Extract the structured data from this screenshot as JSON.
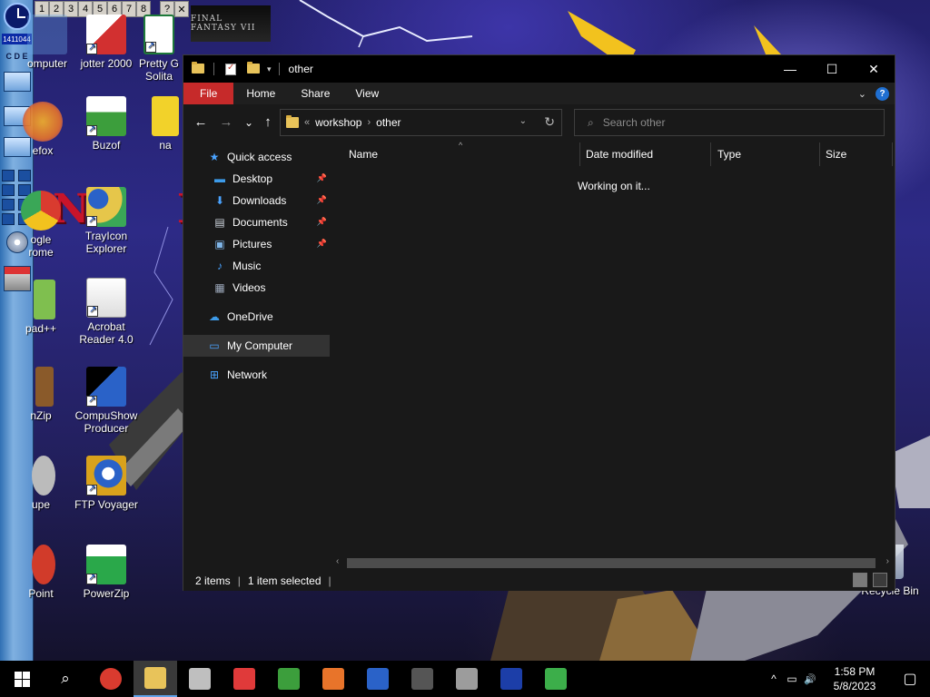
{
  "desktop": {
    "banner_text": "FINAL FANTASY VII",
    "pager": {
      "desktops": [
        "1",
        "2",
        "3",
        "4",
        "5",
        "6",
        "7",
        "8"
      ],
      "help": "?",
      "close": "✕"
    },
    "left_bar": {
      "counter": "1411044",
      "cde": "C D E"
    },
    "icons": [
      {
        "id": "computer",
        "label": "omputer",
        "color": "#6aa6e8"
      },
      {
        "id": "jotter",
        "label": "jotter 2000",
        "color": "#d23030"
      },
      {
        "id": "pretty-good-solitaire",
        "label": "Pretty G Solita",
        "color": "#1e7a3a"
      },
      {
        "id": "firefox",
        "label": "efox",
        "color": "#e8742a"
      },
      {
        "id": "buzof",
        "label": "Buzof",
        "color": "#3c9e3c"
      },
      {
        "id": "na",
        "label": "na",
        "color": "#f2d22a"
      },
      {
        "id": "chrome",
        "label": "ogle\nrome",
        "color": "#d93b2f"
      },
      {
        "id": "trayicon-explorer",
        "label": "TrayIcon\nExplorer",
        "color": "#e6c64a"
      },
      {
        "id": "notepad",
        "label": "pad++",
        "color": "#7fbf4f"
      },
      {
        "id": "acrobat-reader",
        "label": "Acrobat\nReader 4.0",
        "color": "#c8102e"
      },
      {
        "id": "winzip",
        "label": "nZip",
        "color": "#8a5a2a"
      },
      {
        "id": "compushow",
        "label": "CompuShow\nProducer",
        "color": "#2a62c8"
      },
      {
        "id": "loupe",
        "label": "upe",
        "color": "#bbbbbb"
      },
      {
        "id": "ftp-voyager",
        "label": "FTP Voyager",
        "color": "#d9a21c"
      },
      {
        "id": "powerpoint",
        "label": "Point",
        "color": "#d13b2a"
      },
      {
        "id": "powerzip",
        "label": "PowerZip",
        "color": "#2aa84a"
      }
    ],
    "recycle_bin": "Recycle Bin"
  },
  "explorer": {
    "title": "other",
    "controls": {
      "minimize": "—",
      "maximize": "☐",
      "close": "✕"
    },
    "ribbon": {
      "tabs": [
        "File",
        "Home",
        "Share",
        "View"
      ]
    },
    "nav": {
      "back": "←",
      "forward": "→",
      "recent": "⌄",
      "up": "↑"
    },
    "address": {
      "overflow": "«",
      "crumbs": [
        "workshop",
        "other"
      ],
      "separator": "›"
    },
    "search": {
      "placeholder": "Search other"
    },
    "sidebar": [
      {
        "id": "quick-access",
        "label": "Quick access",
        "icon": "star-icon",
        "glyph": "★",
        "color": "#4aa3ff",
        "indent": 1,
        "pinned": false
      },
      {
        "id": "desktop",
        "label": "Desktop",
        "icon": "desktop-icon",
        "glyph": "▬",
        "color": "#3d9be9",
        "indent": 2,
        "pinned": true
      },
      {
        "id": "downloads",
        "label": "Downloads",
        "icon": "download-icon",
        "glyph": "⬇",
        "color": "#4aa3ff",
        "indent": 2,
        "pinned": true
      },
      {
        "id": "documents",
        "label": "Documents",
        "icon": "document-icon",
        "glyph": "▤",
        "color": "#cfd6df",
        "indent": 2,
        "pinned": true
      },
      {
        "id": "pictures",
        "label": "Pictures",
        "icon": "pictures-icon",
        "glyph": "▣",
        "color": "#7fb5e8",
        "indent": 2,
        "pinned": true
      },
      {
        "id": "music",
        "label": "Music",
        "icon": "music-icon",
        "glyph": "♪",
        "color": "#4aa3ff",
        "indent": 2,
        "pinned": false
      },
      {
        "id": "videos",
        "label": "Videos",
        "icon": "video-icon",
        "glyph": "▦",
        "color": "#9aa6b8",
        "indent": 2,
        "pinned": false
      },
      {
        "id": "onedrive",
        "label": "OneDrive",
        "icon": "cloud-icon",
        "glyph": "☁",
        "color": "#3d9be9",
        "indent": 1,
        "pinned": false
      },
      {
        "id": "my-computer",
        "label": "My Computer",
        "icon": "computer-icon",
        "glyph": "▭",
        "color": "#4aa3ff",
        "indent": 1,
        "pinned": false,
        "selected": true
      },
      {
        "id": "network",
        "label": "Network",
        "icon": "network-icon",
        "glyph": "⊞",
        "color": "#4aa3ff",
        "indent": 1,
        "pinned": false
      }
    ],
    "columns": [
      "Name",
      "Date modified",
      "Type",
      "Size"
    ],
    "sort_indicator": "^",
    "loading_text": "Working on it...",
    "status": {
      "item_count": "2 items",
      "selection": "1 item selected",
      "separator": "|"
    }
  },
  "taskbar": {
    "start": "start-icon",
    "search": "search-icon",
    "apps": [
      {
        "id": "chrome",
        "color": "#d93b2f"
      },
      {
        "id": "file-explorer",
        "color": "#e8c35a",
        "active": true
      },
      {
        "id": "disk-tool",
        "color": "#bfbfbf"
      },
      {
        "id": "arrow-app",
        "color": "#e03a3a"
      },
      {
        "id": "buzof",
        "color": "#3c9e3c"
      },
      {
        "id": "firefox",
        "color": "#e8742a"
      },
      {
        "id": "ftp-voyager",
        "color": "#2a62c8"
      },
      {
        "id": "terminal",
        "color": "#555555"
      },
      {
        "id": "cd-tool",
        "color": "#9c9c9c"
      },
      {
        "id": "blue-app",
        "color": "#1c3ea8"
      },
      {
        "id": "recycle-app",
        "color": "#3cae4a"
      }
    ],
    "tray": {
      "chevron": "^",
      "network": "▭",
      "volume": "🔊"
    },
    "time": "1:58 PM",
    "date": "5/8/2023",
    "notifications": "▢"
  }
}
